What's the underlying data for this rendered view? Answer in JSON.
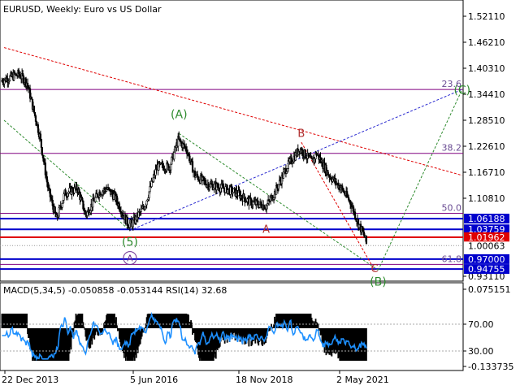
{
  "header": {
    "symbol": "EURUSD",
    "timeframe": "Weekly",
    "description": "Euro vs US Dollar"
  },
  "colors": {
    "candle": "#000000",
    "level_blue": "#0000cc",
    "level_red": "#e00000",
    "fib_line": "#800080",
    "trend_red": "#e00000",
    "trend_blue": "#2a2ad0",
    "trend_green": "#2e8b2e",
    "wave_green": "#2e8b2e",
    "wave_red": "#b03030",
    "macd_line": "#1e90ff",
    "hist_fill": "#000000"
  },
  "chart_data": [
    {
      "type": "candlestick",
      "title": "EURUSD, Weekly: Euro vs US Dollar",
      "x_tick_labels": [
        "22 Dec 2013",
        "5 Jun 2016",
        "18 Nov 2018",
        "2 May 2021"
      ],
      "y_tick_labels": [
        "1.52110",
        "1.46210",
        "1.40310",
        "1.34410",
        "1.28510",
        "1.22610",
        "1.16710",
        "1.10810",
        "0.93110"
      ],
      "ylim": [
        0.905,
        1.545
      ],
      "grid": false,
      "price_badges": [
        {
          "label": "1.06188",
          "value": 1.06188,
          "color": "#0000cc"
        },
        {
          "label": "1.03759",
          "value": 1.03759,
          "color": "#0000cc"
        },
        {
          "label": "1.01962",
          "value": 1.01962,
          "color": "#e00000"
        },
        {
          "label": "0.97000",
          "value": 0.97,
          "color": "#0000cc"
        },
        {
          "label": "0.94755",
          "value": 0.94755,
          "color": "#0000cc"
        }
      ],
      "current_price_label": "1.00063",
      "horizontal_levels": [
        {
          "value": 1.06188,
          "color": "#0000cc",
          "width": 2
        },
        {
          "value": 1.03759,
          "color": "#0000cc",
          "width": 2
        },
        {
          "value": 1.01962,
          "color": "#e00000",
          "width": 2
        },
        {
          "value": 0.97,
          "color": "#0000cc",
          "width": 2
        },
        {
          "value": 0.94755,
          "color": "#0000cc",
          "width": 2
        }
      ],
      "fib_levels": [
        {
          "label": "23.6",
          "value": 1.355
        },
        {
          "label": "38.2",
          "value": 1.21
        },
        {
          "label": "50.0",
          "value": 1.074
        },
        {
          "label": "61.8",
          "value": 0.958
        }
      ],
      "wave_labels": [
        {
          "text": "(A)",
          "style": "green",
          "date": "2018-02",
          "price": 1.29
        },
        {
          "text": "(5)",
          "style": "green",
          "date": "2016-12",
          "price": 1.0
        },
        {
          "text": "B",
          "style": "red",
          "date": "2021-01",
          "price": 1.247
        },
        {
          "text": "A",
          "style": "red",
          "date": "2020-03",
          "price": 1.03
        },
        {
          "text": "C",
          "style": "red",
          "date": "2022-10",
          "price": 0.94
        },
        {
          "text": "(B)",
          "style": "green",
          "date": "2022-11",
          "price": 0.91
        },
        {
          "text": "A",
          "style": "circled",
          "date": "2016-12",
          "price": 0.965
        },
        {
          "text": "(C)",
          "style": "green",
          "date": "2024-11",
          "price": 1.345
        }
      ]
    },
    {
      "type": "indicator",
      "title": "MACD(5,34,5) -0.050858 -0.053144 RSI(14) 32.68",
      "macd_params": "5,34,5",
      "macd_main": -0.050858,
      "macd_signal": -0.053144,
      "rsi_period": 14,
      "rsi_value": 32.68,
      "y_tick_labels": [
        "0.075151",
        "70.00",
        "30.00",
        "-0.133735"
      ]
    }
  ]
}
